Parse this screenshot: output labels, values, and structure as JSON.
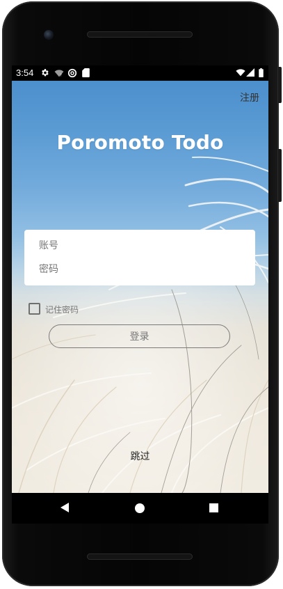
{
  "status_bar": {
    "time": "3:54",
    "icons": [
      "settings-gear-icon",
      "wifi-calling-icon",
      "sync-circle-icon",
      "sd-card-icon",
      "wifi-signal-icon",
      "cell-signal-icon",
      "battery-icon"
    ]
  },
  "header": {
    "register_label": "注册"
  },
  "app": {
    "title": "Poromoto Todo"
  },
  "login_form": {
    "account_placeholder": "账号",
    "account_value": "",
    "password_placeholder": "密码",
    "password_value": "",
    "remember_label": "记住密码",
    "remember_checked": false,
    "login_label": "登录"
  },
  "footer": {
    "skip_label": "跳过"
  },
  "nav_bar": {
    "buttons": [
      "back-icon",
      "home-icon",
      "recents-icon"
    ]
  },
  "colors": {
    "sky_top": "#4c8fcd",
    "sky_bottom": "#f1ece2",
    "title_text": "#ffffff",
    "card_bg": "#ffffff",
    "button_border": "#7a7a7a"
  }
}
